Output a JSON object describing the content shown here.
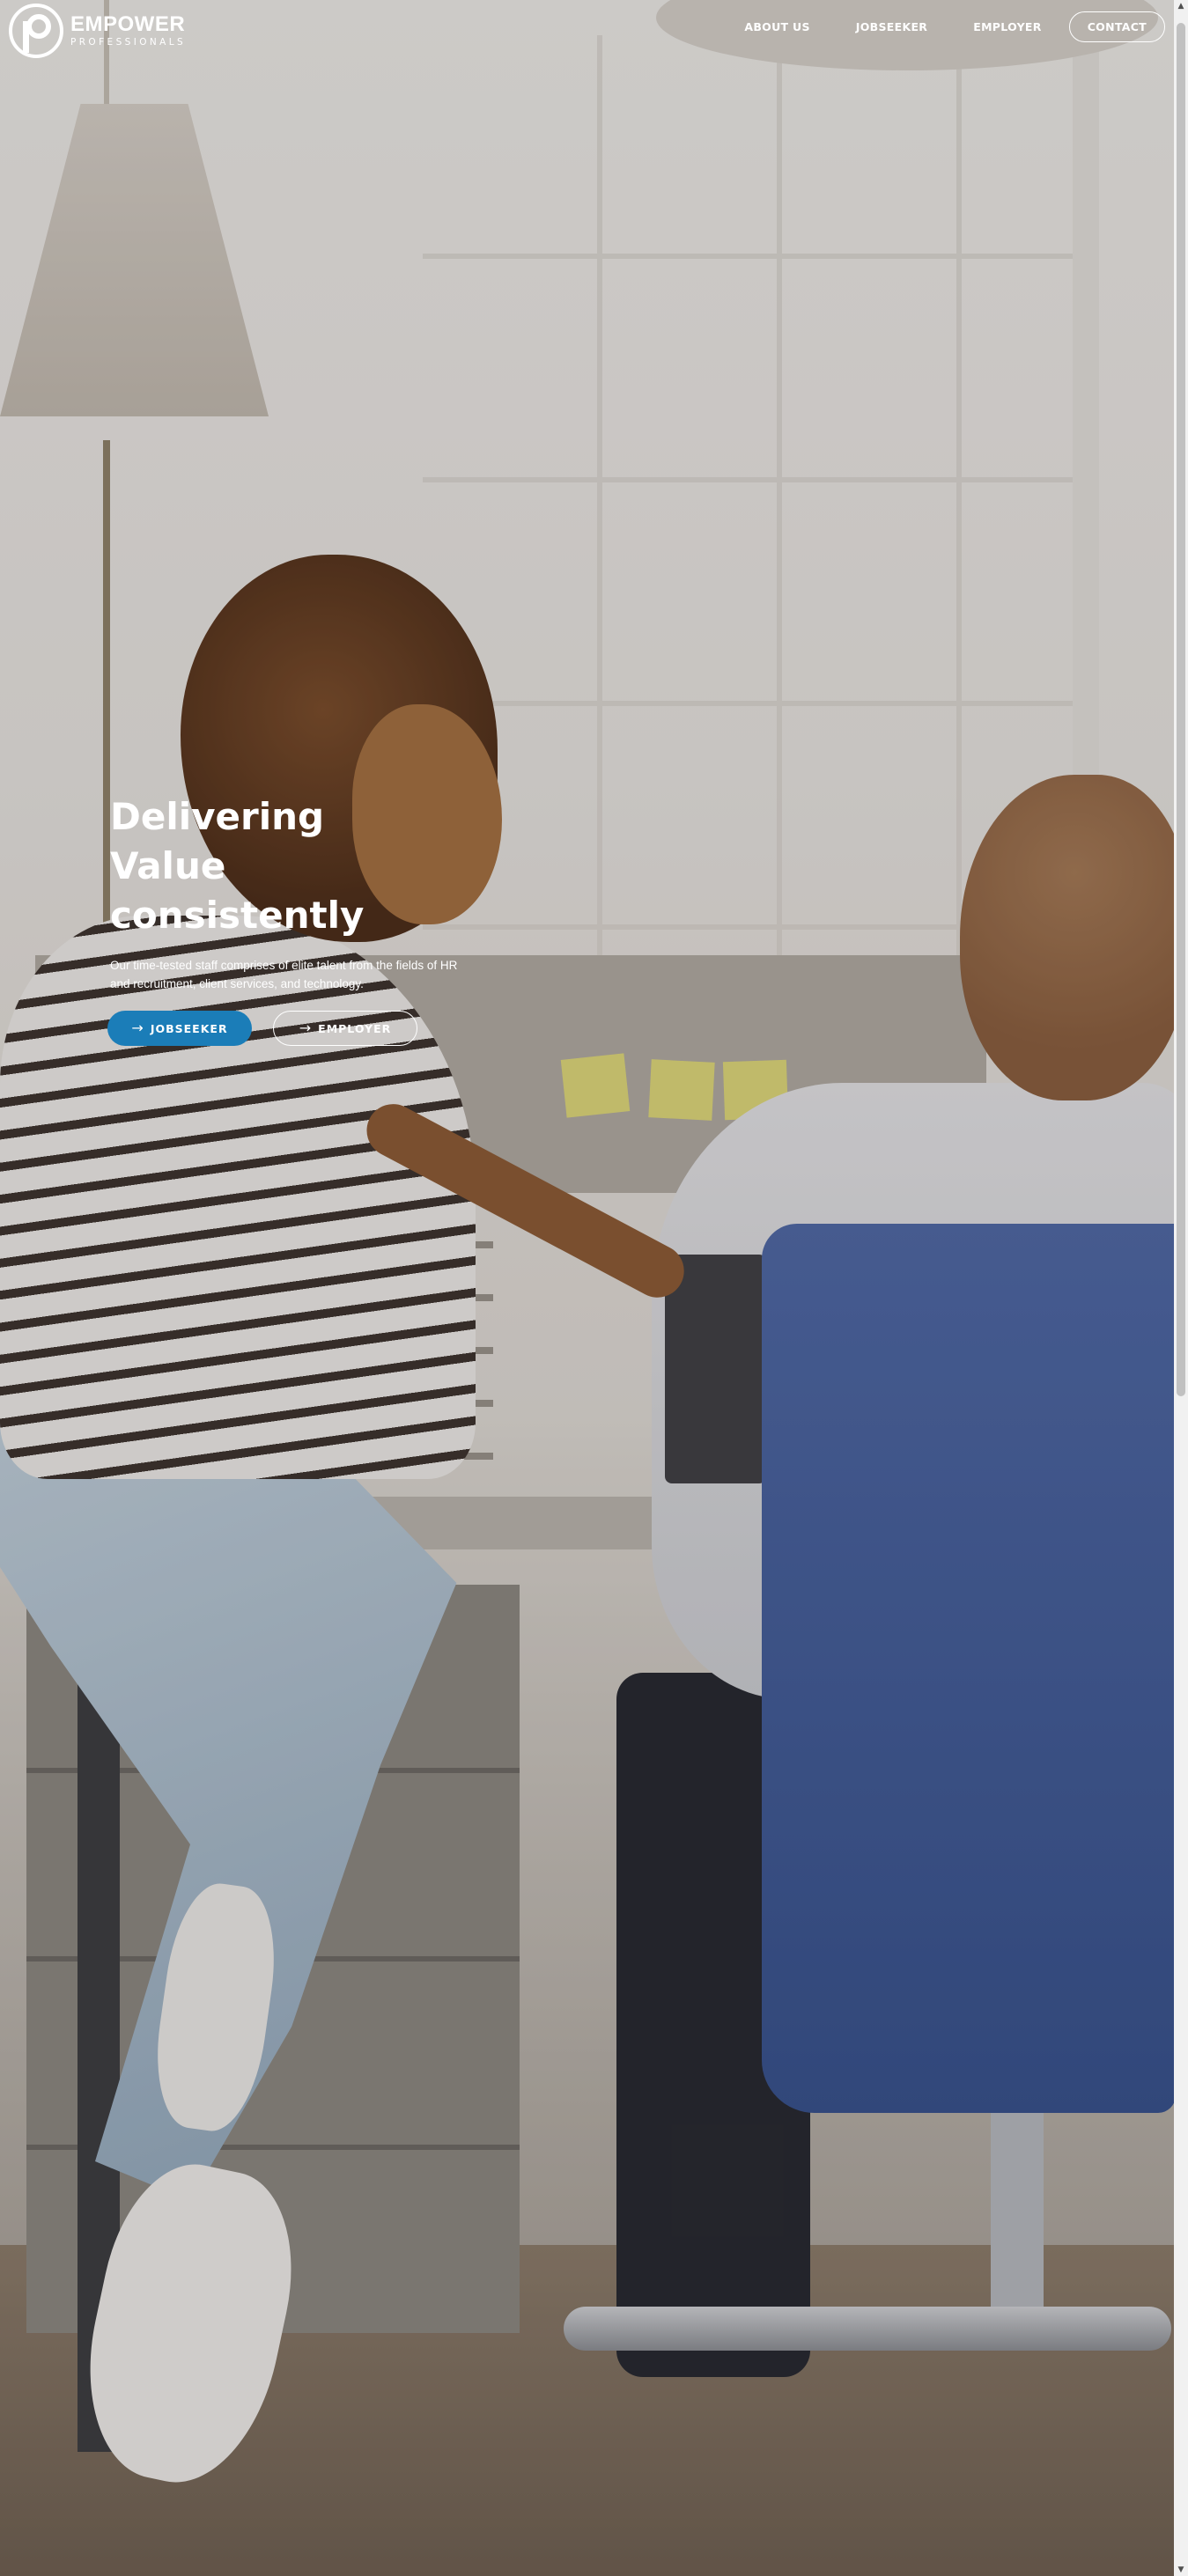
{
  "brand": {
    "name": "EMPOWER",
    "tagline": "PROFESSIONALS",
    "logo_icon": "empower-p-logo-icon"
  },
  "nav": {
    "items": [
      {
        "label": "ABOUT US"
      },
      {
        "label": "JOBSEEKER"
      },
      {
        "label": "EMPLOYER"
      }
    ],
    "contact_label": "CONTACT"
  },
  "hero": {
    "title_lines": [
      "Delivering",
      "Value",
      "consistently"
    ],
    "subtitle": "Our time-tested staff comprises of elite talent from the fields of HR and recruitment, client services, and technology.",
    "buttons": {
      "jobseeker_label": "JOBSEEKER",
      "employer_label": "EMPLOYER",
      "arrow_icon": "arrow-right-icon"
    },
    "background_image": "office-team-photo"
  },
  "colors": {
    "accent": "#1b7db8",
    "text_on_image": "#ffffff"
  },
  "scrollbar": {
    "up_icon": "scroll-up-arrow-icon",
    "down_icon": "scroll-down-arrow-icon"
  }
}
